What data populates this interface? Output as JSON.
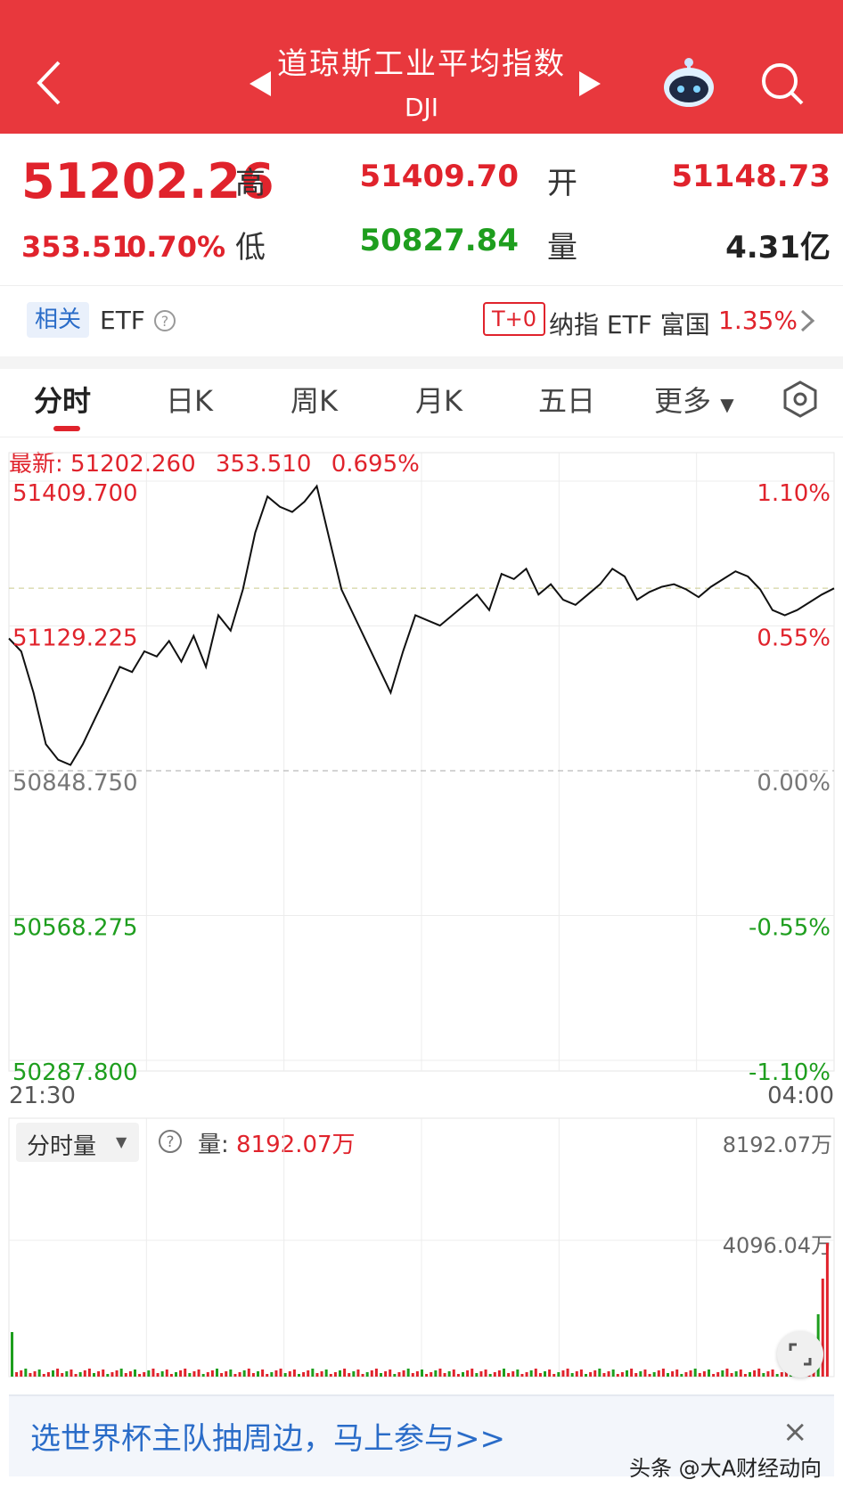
{
  "header": {
    "title": "道琼斯工业平均指数",
    "code": "DJI"
  },
  "quote": {
    "last": "51202.26",
    "change": "353.51",
    "change_pct": "0.70%",
    "high_label": "高",
    "high": "51409.70",
    "low_label": "低",
    "low": "50827.84",
    "open_label": "开",
    "open": "51148.73",
    "volume_label": "量",
    "volume": "4.31亿"
  },
  "etf": {
    "related_tag": "相关",
    "label": "ETF",
    "t0_badge": "T+0",
    "fund_name": "纳指 ETF 富国",
    "fund_change": "1.35%"
  },
  "tabs": [
    "分时",
    "日K",
    "周K",
    "月K",
    "五日",
    "更多"
  ],
  "chart": {
    "latest_label": "最新:",
    "latest_value": "51202.260",
    "latest_change": "353.510",
    "latest_pct": "0.695%",
    "left_labels": [
      "51409.700",
      "51129.225",
      "50848.750",
      "50568.275",
      "50287.800"
    ],
    "right_labels": [
      "1.10%",
      "0.55%",
      "0.00%",
      "-0.55%",
      "-1.10%"
    ],
    "time_start": "21:30",
    "time_end": "04:00",
    "colors": {
      "up": "#e0232c",
      "down": "#1e9e1e",
      "line": "#111111"
    }
  },
  "chart_data": {
    "type": "line",
    "title": "",
    "xlabel": "",
    "ylabel": "",
    "x_range": [
      "21:30",
      "04:00"
    ],
    "ylim": [
      50287.8,
      51409.7
    ],
    "baseline": 50848.75,
    "series": [
      {
        "values": [
          51105,
          51080,
          51000,
          50900,
          50870,
          50860,
          50900,
          50950,
          51000,
          51050,
          51040,
          51080,
          51070,
          51100,
          51060,
          51110,
          51050,
          51150,
          51120,
          51200,
          51310,
          51380,
          51360,
          51350,
          51370,
          51400,
          51300,
          51200,
          51150,
          51100,
          51050,
          51000,
          51080,
          51150,
          51140,
          51130,
          51150,
          51170,
          51190,
          51160,
          51230,
          51220,
          51240,
          51190,
          51210,
          51180,
          51170,
          51190,
          51210,
          51240,
          51225,
          51180,
          51195,
          51205,
          51210,
          51200,
          51185,
          51205,
          51220,
          51235,
          51225,
          51200,
          51160,
          51150,
          51160,
          51175,
          51190,
          51202
        ]
      }
    ]
  },
  "volume": {
    "selector_label": "分时量",
    "help_icon": "question-circle-icon",
    "vol_label": "量:",
    "vol_value": "8192.07万",
    "max_label": "8192.07万",
    "mid_label": "4096.04万",
    "expand_icon": "expand-icon"
  },
  "banner": {
    "text": "选世界杯主队抽周边，马上参与>>",
    "close": "×"
  },
  "watermark": "头条 @大A财经动向"
}
